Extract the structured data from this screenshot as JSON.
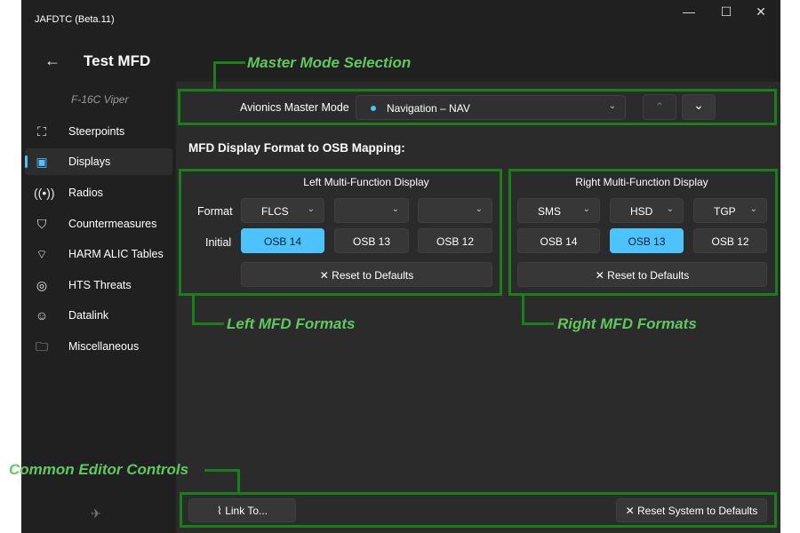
{
  "window": {
    "title": "JAFDTC (Beta.11)",
    "minimize_icon": "minimize-icon",
    "maximize_icon": "maximize-icon",
    "close_icon": "close-icon"
  },
  "header": {
    "back_icon": "arrow-left-icon",
    "title": "Test MFD",
    "airframe": "F-16C Viper"
  },
  "sidebar": {
    "items": [
      {
        "label": "Steerpoints",
        "icon": "steerpoint-icon"
      },
      {
        "label": "Displays",
        "icon": "display-chip-icon",
        "active": true
      },
      {
        "label": "Radios",
        "icon": "radio-antenna-icon"
      },
      {
        "label": "Countermeasures",
        "icon": "shield-icon"
      },
      {
        "label": "HARM ALIC Tables",
        "icon": "wifi-icon"
      },
      {
        "label": "HTS Threats",
        "icon": "target-icon"
      },
      {
        "label": "Datalink",
        "icon": "people-icon"
      },
      {
        "label": "Miscellaneous",
        "icon": "folder-icon"
      }
    ],
    "settings_icon": "plane-icon"
  },
  "master_mode": {
    "label": "Avionics Master Mode",
    "selected": "Navigation – NAV",
    "status_color": "#4cc2ff"
  },
  "section_title": "MFD Display Format to OSB Mapping:",
  "left_mfd": {
    "title": "Left Multi-Function Display",
    "format_label": "Format",
    "initial_label": "Initial",
    "formats": [
      "FLCS",
      "",
      ""
    ],
    "osbs": [
      "OSB 14",
      "OSB 13",
      "OSB 12"
    ],
    "selected_osb": 0,
    "reset_label": "Reset to Defaults"
  },
  "right_mfd": {
    "title": "Right Multi-Function Display",
    "formats": [
      "SMS",
      "HSD",
      "TGP"
    ],
    "osbs": [
      "OSB 14",
      "OSB 13",
      "OSB 12"
    ],
    "selected_osb": 1,
    "reset_label": "Reset to Defaults"
  },
  "footer": {
    "link_label": "Link To...",
    "reset_system_label": "Reset System to Defaults"
  },
  "annotations": {
    "master_mode": "Master Mode Selection",
    "left_mfd": "Left MFD Formats",
    "right_mfd": "Right MFD Formats",
    "common": "Common Editor Controls"
  },
  "colors": {
    "accent": "#4cc2ff",
    "annotation": "#5fc95f",
    "annotation_box": "#1a7f1a"
  }
}
